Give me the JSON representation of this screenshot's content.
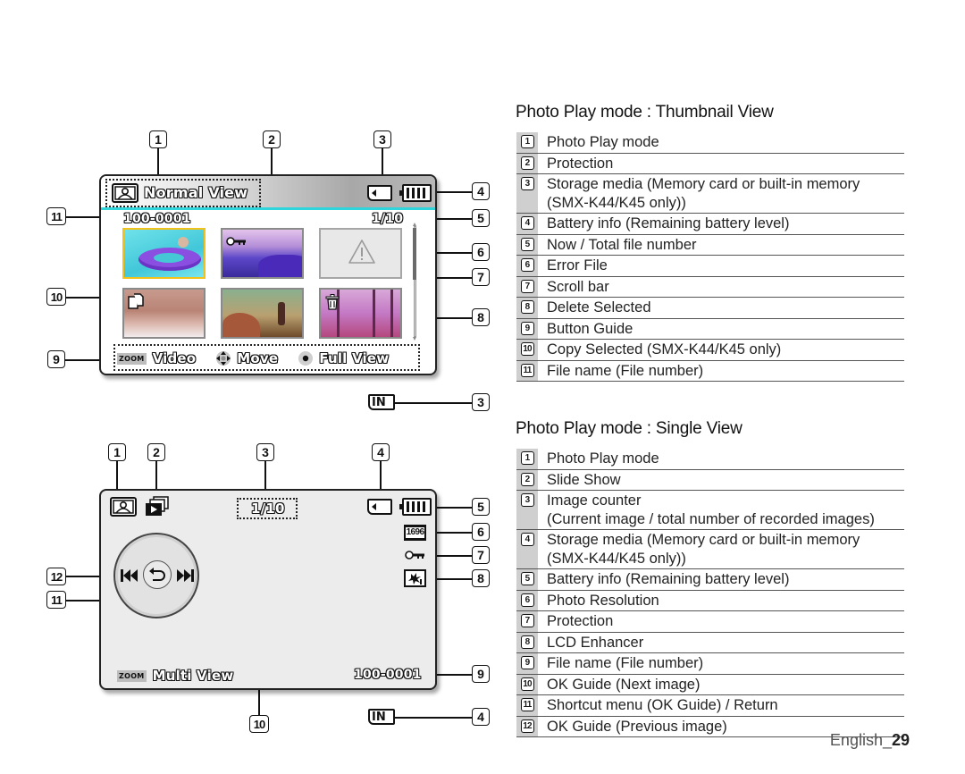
{
  "thumbnail_view": {
    "title": "Photo Play mode : Thumbnail View",
    "screen": {
      "mode_label": "Normal View",
      "file_name": "100-0001",
      "counter": "1/10",
      "button_guide": {
        "zoom_tag": "ZOOM",
        "zoom_action": "Video",
        "move_action": "Move",
        "ok_action": "Full View"
      },
      "storage_icon_alt": "IN",
      "header_accent_color": "#2ED6DC",
      "selected_border_color": "#F2C21B"
    },
    "callouts": [
      "1",
      "2",
      "3",
      "4",
      "5",
      "6",
      "7",
      "8",
      "9",
      "10",
      "11",
      "3"
    ],
    "legend": [
      {
        "num": "1",
        "text": "Photo Play mode"
      },
      {
        "num": "2",
        "text": "Protection"
      },
      {
        "num": "3",
        "text": "Storage media (Memory card or built-in memory (SMX-K44/K45 only))"
      },
      {
        "num": "4",
        "text": "Battery info (Remaining battery level)"
      },
      {
        "num": "5",
        "text": "Now / Total file number"
      },
      {
        "num": "6",
        "text": "Error File"
      },
      {
        "num": "7",
        "text": "Scroll bar"
      },
      {
        "num": "8",
        "text": "Delete Selected"
      },
      {
        "num": "9",
        "text": "Button Guide"
      },
      {
        "num": "10",
        "text": "Copy Selected (SMX-K44/K45 only)"
      },
      {
        "num": "11",
        "text": "File name (File number)"
      }
    ]
  },
  "single_view": {
    "title": "Photo Play mode : Single View",
    "screen": {
      "counter": "1/10",
      "resolution": "1696",
      "zoom_tag": "ZOOM",
      "zoom_action": "Multi View",
      "file_name": "100-0001",
      "storage_icon_alt": "IN"
    },
    "callouts": [
      "1",
      "2",
      "3",
      "4",
      "5",
      "6",
      "7",
      "8",
      "9",
      "10",
      "11",
      "12",
      "4"
    ],
    "legend": [
      {
        "num": "1",
        "text": "Photo Play mode"
      },
      {
        "num": "2",
        "text": "Slide Show"
      },
      {
        "num": "3",
        "text": "Image counter\n(Current image / total number of recorded images)"
      },
      {
        "num": "4",
        "text": "Storage media (Memory card or built-in memory (SMX-K44/K45 only))"
      },
      {
        "num": "5",
        "text": "Battery info (Remaining battery level)"
      },
      {
        "num": "6",
        "text": "Photo Resolution"
      },
      {
        "num": "7",
        "text": "Protection"
      },
      {
        "num": "8",
        "text": "LCD Enhancer"
      },
      {
        "num": "9",
        "text": "File name (File number)"
      },
      {
        "num": "10",
        "text": "OK Guide (Next image)"
      },
      {
        "num": "11",
        "text": "Shortcut menu (OK Guide) / Return"
      },
      {
        "num": "12",
        "text": "OK Guide (Previous image)"
      }
    ]
  },
  "footer": {
    "language": "English_",
    "page_number": "29"
  }
}
